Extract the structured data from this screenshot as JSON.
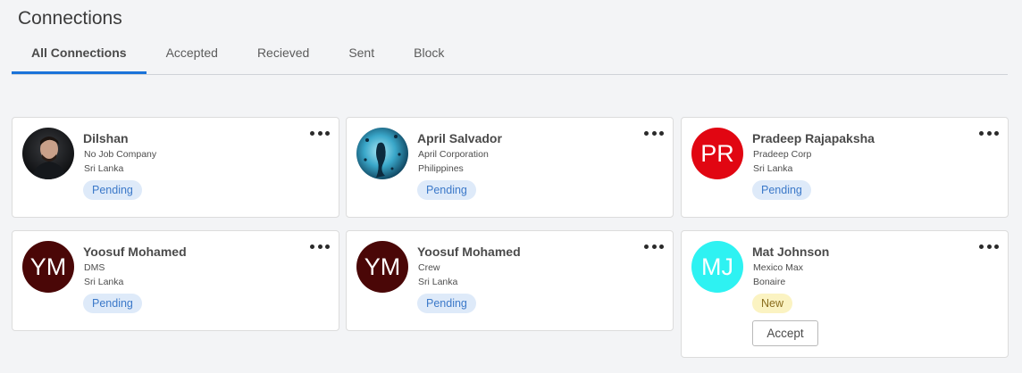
{
  "page": {
    "title": "Connections"
  },
  "tabs": [
    {
      "label": "All Connections",
      "active": true
    },
    {
      "label": "Accepted",
      "active": false
    },
    {
      "label": "Recieved",
      "active": false
    },
    {
      "label": "Sent",
      "active": false
    },
    {
      "label": "Block",
      "active": false
    }
  ],
  "cards": [
    {
      "name": "Dilshan",
      "company": "No Job Company",
      "country": "Sri Lanka",
      "status": "Pending",
      "avatar": {
        "type": "photo",
        "icon": "person-photo-avatar"
      }
    },
    {
      "name": "April Salvador",
      "company": "April Corporation",
      "country": "Philippines",
      "status": "Pending",
      "avatar": {
        "type": "photo",
        "icon": "mermaid-photo-avatar"
      }
    },
    {
      "name": "Pradeep Rajapaksha",
      "company": "Pradeep Corp",
      "country": "Sri Lanka",
      "status": "Pending",
      "avatar": {
        "type": "initials",
        "initials": "PR",
        "color": "#e10612"
      }
    },
    {
      "name": "Yoosuf Mohamed",
      "company": "DMS",
      "country": "Sri Lanka",
      "status": "Pending",
      "avatar": {
        "type": "initials",
        "initials": "YM",
        "color": "#4a0707"
      }
    },
    {
      "name": "Yoosuf Mohamed",
      "company": "Crew",
      "country": "Sri Lanka",
      "status": "Pending",
      "avatar": {
        "type": "initials",
        "initials": "YM",
        "color": "#4a0707"
      }
    },
    {
      "name": "Mat Johnson",
      "company": "Mexico Max",
      "country": "Bonaire",
      "status": "New",
      "action": "Accept",
      "avatar": {
        "type": "initials",
        "initials": "MJ",
        "color": "#2ef2f2"
      }
    }
  ],
  "colors": {
    "accent": "#1a73d9",
    "pending_bg": "#deeaf9",
    "pending_text": "#3c79c9",
    "new_bg": "#fbf3c2",
    "new_text": "#8a6d1d"
  },
  "icons": {
    "more": "more-dots-icon"
  }
}
